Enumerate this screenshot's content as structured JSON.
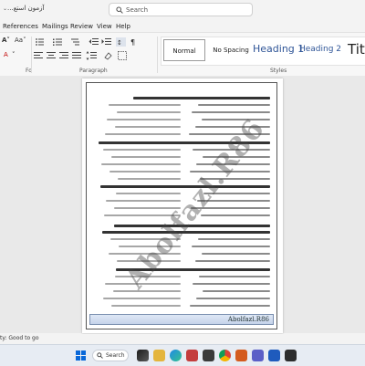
{
  "titlebar": {
    "doc_title": "آزمون استع...",
    "search_placeholder": "Search"
  },
  "menu": [
    "References",
    "Mailings",
    "Review",
    "View",
    "Help"
  ],
  "ribbon": {
    "paragraph_label": "Paragraph",
    "styles_label": "Styles",
    "fn_label": "Fo",
    "styles": [
      "Normal",
      "No Spacing",
      "Heading 1",
      "Heading 2",
      "Title"
    ],
    "style_colors": {
      "normal": "#222222",
      "no_spacing": "#222222",
      "heading1": "#2f5597",
      "heading2": "#2f5597",
      "title": "#222222"
    },
    "font_color": "#c00000"
  },
  "document": {
    "watermark": "Abolfazl.R86",
    "footer": "Abolfazl.R86"
  },
  "status": {
    "text": "ty: Good to go"
  },
  "taskbar": {
    "search_label": "Search",
    "background": "#e7ecf3"
  }
}
